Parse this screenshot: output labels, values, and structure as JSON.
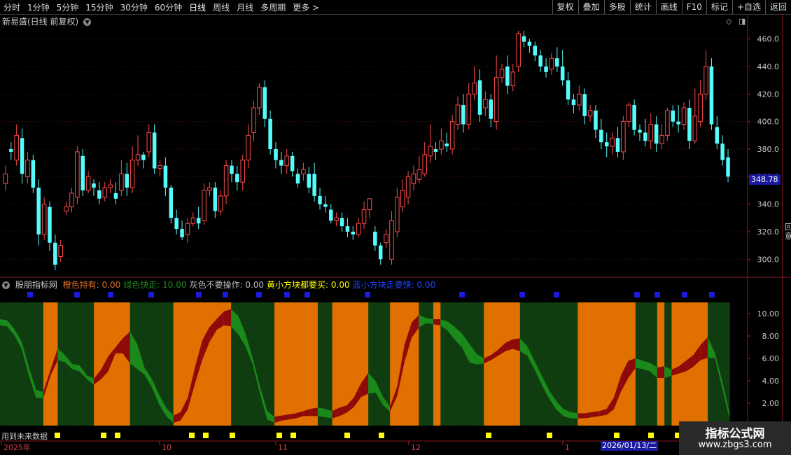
{
  "toolbar": {
    "periods": [
      "分时",
      "1分钟",
      "5分钟",
      "15分钟",
      "30分钟",
      "60分钟",
      "日线",
      "周线",
      "月线",
      "多周期",
      "更多 >"
    ],
    "active_period": "日线",
    "right_buttons": [
      "复权",
      "叠加",
      "多股",
      "统计",
      "画线",
      "F10",
      "标记",
      "+自选",
      "返回"
    ]
  },
  "stock": {
    "title": "新易盛(日线 前复权)",
    "last_price": "348.78"
  },
  "price_axis": [
    "460.0",
    "440.0",
    "420.0",
    "400.0",
    "380.0",
    "360.0",
    "340.0",
    "320.0",
    "300.0"
  ],
  "indicator": {
    "name": "股朋指标网",
    "legend": [
      {
        "text": "橙色持有: 0.00",
        "color": "#e07020"
      },
      {
        "text": "绿色快走: 10.00",
        "color": "#1a8a1a"
      },
      {
        "text": "灰色不要操作: 0.00",
        "color": "#bbbbbb"
      },
      {
        "text": "黄小方块都要买: 0.00",
        "color": "#ffff00"
      },
      {
        "text": "蓝小方块走要快: 0.00",
        "color": "#2244ff"
      }
    ],
    "axis": [
      "10.00",
      "8.00",
      "6.00",
      "4.00",
      "2.00"
    ]
  },
  "future_label": "用到未来数据",
  "date_axis": [
    "2025年",
    "10",
    "11",
    "12",
    "1"
  ],
  "cursor_date": "2026/01/13/二",
  "side_chars": [
    "回",
    "意"
  ],
  "watermark": {
    "line1": "指标公式网",
    "line2": "www.zbgs3.com"
  },
  "colors": {
    "up": "#ff4a4a",
    "down": "#54fcfc",
    "orange": "#e07000",
    "darkgreen": "#0f3d10",
    "redwave": "#8c0a0a",
    "greenwave": "#1a8a1a",
    "blue": "#1a1ae0",
    "yellow": "#ffff00"
  },
  "chart_data": [
    {
      "type": "candlestick",
      "title": "新易盛(日线 前复权)",
      "ylim": [
        290,
        470
      ],
      "candles": [
        [
          355,
          362,
          350,
          368
        ],
        [
          380,
          378,
          372,
          385
        ],
        [
          372,
          390,
          368,
          398
        ],
        [
          388,
          362,
          355,
          395
        ],
        [
          360,
          372,
          355,
          378
        ],
        [
          372,
          352,
          348,
          376
        ],
        [
          352,
          318,
          310,
          358
        ],
        [
          318,
          340,
          314,
          345
        ],
        [
          338,
          312,
          306,
          342
        ],
        [
          312,
          296,
          292,
          318
        ],
        [
          302,
          310,
          298,
          314
        ],
        [
          335,
          338,
          332,
          342
        ],
        [
          338,
          348,
          334,
          352
        ],
        [
          345,
          378,
          340,
          382
        ],
        [
          375,
          350,
          346,
          380
        ],
        [
          350,
          360,
          348,
          364
        ],
        [
          355,
          352,
          346,
          358
        ],
        [
          350,
          344,
          340,
          356
        ],
        [
          345,
          352,
          342,
          356
        ],
        [
          352,
          354,
          348,
          358
        ],
        [
          348,
          344,
          340,
          356
        ],
        [
          350,
          362,
          346,
          372
        ],
        [
          362,
          352,
          346,
          370
        ],
        [
          352,
          372,
          348,
          382
        ],
        [
          372,
          376,
          368,
          390
        ],
        [
          376,
          372,
          366,
          378
        ],
        [
          378,
          392,
          374,
          398
        ],
        [
          392,
          366,
          362,
          398
        ],
        [
          366,
          368,
          360,
          372
        ],
        [
          368,
          352,
          346,
          374
        ],
        [
          352,
          330,
          326,
          354
        ],
        [
          330,
          322,
          318,
          336
        ],
        [
          322,
          316,
          314,
          328
        ],
        [
          318,
          326,
          312,
          330
        ],
        [
          326,
          330,
          324,
          334
        ],
        [
          330,
          326,
          322,
          338
        ],
        [
          328,
          350,
          325,
          355
        ],
        [
          350,
          352,
          346,
          356
        ],
        [
          352,
          335,
          330,
          356
        ],
        [
          335,
          346,
          332,
          350
        ],
        [
          346,
          368,
          340,
          372
        ],
        [
          368,
          362,
          356,
          372
        ],
        [
          362,
          356,
          350,
          368
        ],
        [
          356,
          372,
          350,
          376
        ],
        [
          372,
          390,
          366,
          398
        ],
        [
          392,
          410,
          386,
          415
        ],
        [
          410,
          425,
          405,
          428
        ],
        [
          425,
          402,
          396,
          430
        ],
        [
          402,
          380,
          376,
          408
        ],
        [
          380,
          372,
          366,
          385
        ],
        [
          372,
          368,
          362,
          378
        ],
        [
          368,
          375,
          362,
          380
        ],
        [
          375,
          364,
          360,
          378
        ],
        [
          362,
          355,
          352,
          366
        ],
        [
          362,
          365,
          357,
          370
        ],
        [
          362,
          352,
          348,
          367
        ],
        [
          362,
          346,
          342,
          370
        ],
        [
          346,
          340,
          336,
          352
        ],
        [
          340,
          338,
          334,
          346
        ],
        [
          336,
          328,
          326,
          340
        ],
        [
          328,
          330,
          324,
          334
        ],
        [
          330,
          324,
          320,
          334
        ],
        [
          324,
          320,
          316,
          330
        ],
        [
          320,
          318,
          314,
          324
        ],
        [
          318,
          326,
          316,
          330
        ],
        [
          326,
          336,
          322,
          342
        ],
        [
          336,
          344,
          330,
          344
        ],
        [
          320,
          310,
          306,
          324
        ],
        [
          310,
          300,
          296,
          312
        ],
        [
          312,
          318,
          308,
          322
        ],
        [
          300,
          328,
          296,
          335
        ],
        [
          320,
          345,
          316,
          352
        ],
        [
          338,
          350,
          334,
          358
        ],
        [
          345,
          360,
          340,
          364
        ],
        [
          355,
          362,
          350,
          368
        ],
        [
          358,
          365,
          355,
          375
        ],
        [
          362,
          376,
          360,
          385
        ],
        [
          375,
          382,
          370,
          398
        ],
        [
          380,
          378,
          372,
          385
        ],
        [
          380,
          386,
          376,
          395
        ],
        [
          384,
          382,
          378,
          392
        ],
        [
          380,
          400,
          376,
          405
        ],
        [
          398,
          412,
          394,
          418
        ],
        [
          412,
          398,
          392,
          420
        ],
        [
          398,
          420,
          394,
          428
        ],
        [
          420,
          428,
          416,
          440
        ],
        [
          430,
          405,
          400,
          438
        ],
        [
          410,
          416,
          404,
          422
        ],
        [
          416,
          402,
          396,
          420
        ],
        [
          400,
          432,
          394,
          448
        ],
        [
          432,
          438,
          428,
          442
        ],
        [
          440,
          426,
          420,
          448
        ],
        [
          426,
          436,
          422,
          442
        ],
        [
          440,
          464,
          436,
          466
        ],
        [
          462,
          458,
          454,
          466
        ],
        [
          458,
          455,
          450,
          460
        ],
        [
          455,
          448,
          444,
          458
        ],
        [
          448,
          440,
          436,
          452
        ],
        [
          440,
          436,
          432,
          446
        ],
        [
          438,
          446,
          434,
          450
        ],
        [
          446,
          440,
          436,
          454
        ],
        [
          440,
          430,
          426,
          452
        ],
        [
          430,
          416,
          412,
          436
        ],
        [
          416,
          412,
          406,
          420
        ],
        [
          412,
          420,
          408,
          426
        ],
        [
          420,
          404,
          398,
          424
        ],
        [
          404,
          408,
          400,
          412
        ],
        [
          408,
          394,
          388,
          412
        ],
        [
          394,
          385,
          380,
          402
        ],
        [
          385,
          382,
          374,
          392
        ],
        [
          382,
          388,
          376,
          392
        ],
        [
          388,
          378,
          374,
          396
        ],
        [
          378,
          400,
          372,
          404
        ],
        [
          400,
          412,
          396,
          414
        ],
        [
          412,
          394,
          390,
          416
        ],
        [
          394,
          392,
          386,
          398
        ],
        [
          392,
          386,
          382,
          402
        ],
        [
          386,
          398,
          380,
          406
        ],
        [
          398,
          384,
          378,
          404
        ],
        [
          384,
          390,
          380,
          398
        ],
        [
          390,
          408,
          386,
          410
        ],
        [
          408,
          400,
          396,
          412
        ],
        [
          400,
          398,
          392,
          412
        ],
        [
          398,
          410,
          394,
          414
        ],
        [
          410,
          386,
          380,
          416
        ],
        [
          386,
          404,
          384,
          424
        ],
        [
          400,
          420,
          396,
          430
        ],
        [
          420,
          440,
          416,
          452
        ],
        [
          440,
          398,
          394,
          446
        ],
        [
          396,
          384,
          380,
          404
        ],
        [
          384,
          372,
          368,
          390
        ],
        [
          374,
          360,
          356,
          380
        ]
      ]
    },
    {
      "type": "area",
      "title": "股朋指标网",
      "ylim": [
        0,
        11
      ],
      "x": [
        0,
        10,
        20,
        30,
        40,
        50,
        60,
        70,
        80,
        90,
        100,
        110,
        120,
        130
      ],
      "upper": [
        9.3,
        9.2,
        8.6,
        7.5,
        5.2,
        3.2,
        3.0,
        5.0,
        6.9,
        6.3,
        5.5,
        5.4,
        4.5,
        4.0,
        4.5,
        5.2,
        6.8,
        7.8,
        8.4,
        7.3,
        5.2,
        4.2,
        2.8,
        1.6,
        0.9,
        1.2,
        2.5,
        5.2,
        7.6,
        8.8,
        9.5,
        10.2,
        10.4,
        9.8,
        8.2,
        6.0,
        3.5,
        1.3,
        0.8,
        0.9,
        1.0,
        1.1,
        1.3,
        1.5,
        1.6,
        1.5,
        1.3,
        1.6,
        1.8,
        2.5,
        3.8,
        4.7,
        4.0,
        2.6,
        1.7,
        3.5,
        7.2,
        9.2,
        9.9,
        9.6,
        9.4,
        9.5,
        9.3,
        8.8,
        8.2,
        7.3,
        6.4,
        6.0,
        6.3,
        6.8,
        7.4,
        7.7,
        7.8,
        7.1,
        5.8,
        4.5,
        3.2,
        2.2,
        1.5,
        1.2,
        1.1,
        1.1,
        1.2,
        1.3,
        1.5,
        2.5,
        4.5,
        5.8,
        6.0,
        5.8,
        5.6,
        5.2,
        5.3,
        5.0,
        5.3,
        5.8,
        6.3,
        7.2,
        7.9,
        6.5,
        4.0,
        1.2
      ],
      "lower": [
        9.5,
        9.4,
        8.4,
        7.2,
        4.8,
        2.8,
        2.8,
        4.8,
        6.2,
        6.0,
        5.4,
        5.2,
        4.5,
        4.2,
        5.0,
        6.2,
        7.0,
        6.8,
        5.9,
        5.4,
        4.9,
        3.8,
        2.3,
        1.2,
        0.6,
        0.8,
        1.8,
        4.1,
        6.2,
        7.8,
        8.9,
        9.3,
        9.2,
        8.5,
        7.4,
        5.8,
        3.2,
        0.9,
        0.6,
        0.8,
        0.9,
        1.0,
        1.2,
        1.2,
        1.2,
        1.1,
        1.0,
        1.2,
        1.5,
        2.0,
        2.9,
        3.2,
        3.3,
        2.2,
        1.6,
        3.0,
        6.0,
        8.2,
        9.1,
        9.5,
        9.5,
        9.3,
        8.8,
        8.0,
        7.3,
        6.0,
        5.8,
        5.9,
        6.2,
        6.6,
        7.0,
        7.2,
        7.0,
        6.6,
        5.4,
        4.0,
        2.8,
        1.8,
        1.2,
        1.0,
        1.0,
        1.0,
        1.1,
        1.2,
        1.3,
        1.8,
        3.4,
        4.6,
        5.5,
        5.4,
        5.2,
        4.6,
        4.6,
        4.8,
        5.0,
        5.2,
        5.6,
        6.2,
        6.4,
        6.4,
        3.7,
        1.0
      ]
    }
  ]
}
